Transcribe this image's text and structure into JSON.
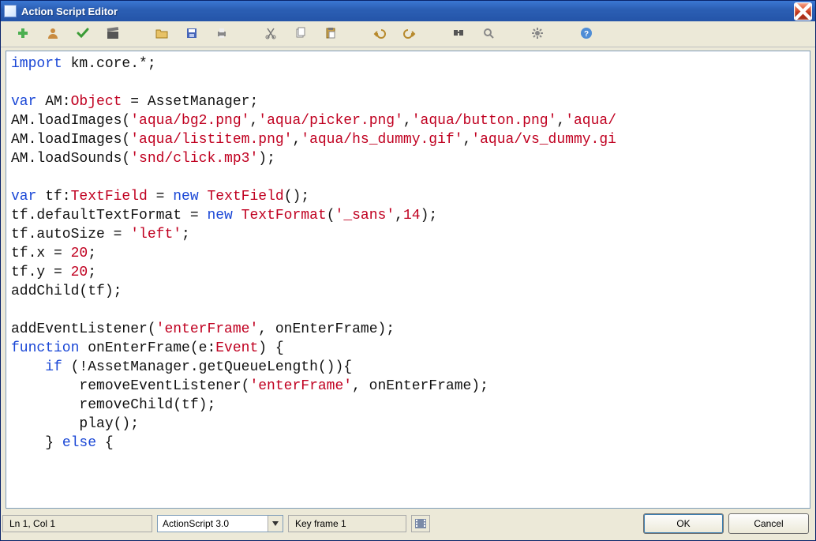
{
  "window": {
    "title": "Action Script Editor"
  },
  "toolbar": {
    "icons": [
      "add",
      "user",
      "check",
      "clapper",
      "_sep",
      "open",
      "save",
      "print",
      "_sep",
      "cut",
      "copy",
      "paste",
      "_sep",
      "undo",
      "redo",
      "_sep",
      "find",
      "goto",
      "_sep",
      "settings",
      "_sep",
      "help"
    ]
  },
  "code": {
    "tokens": [
      [
        [
          "kw",
          "import"
        ],
        [
          "",
          " km.core.*;"
        ]
      ],
      [],
      [
        [
          "kw",
          "var"
        ],
        [
          "",
          " AM:"
        ],
        [
          "typ",
          "Object"
        ],
        [
          "",
          " = AssetManager;"
        ]
      ],
      [
        [
          "",
          "AM.loadImages("
        ],
        [
          "str",
          "'aqua/bg2.png'"
        ],
        [
          "",
          ","
        ],
        [
          "str",
          "'aqua/picker.png'"
        ],
        [
          "",
          ","
        ],
        [
          "str",
          "'aqua/button.png'"
        ],
        [
          "",
          ","
        ],
        [
          "str",
          "'aqua/"
        ]
      ],
      [
        [
          "",
          "AM.loadImages("
        ],
        [
          "str",
          "'aqua/listitem.png'"
        ],
        [
          "",
          ","
        ],
        [
          "str",
          "'aqua/hs_dummy.gif'"
        ],
        [
          "",
          ","
        ],
        [
          "str",
          "'aqua/vs_dummy.gi"
        ]
      ],
      [
        [
          "",
          "AM.loadSounds("
        ],
        [
          "str",
          "'snd/click.mp3'"
        ],
        [
          "",
          ");"
        ]
      ],
      [],
      [
        [
          "kw",
          "var"
        ],
        [
          "",
          " tf:"
        ],
        [
          "typ",
          "TextField"
        ],
        [
          "",
          " = "
        ],
        [
          "kw",
          "new"
        ],
        [
          "",
          " "
        ],
        [
          "typ",
          "TextField"
        ],
        [
          "",
          "();"
        ]
      ],
      [
        [
          "",
          "tf.defaultTextFormat = "
        ],
        [
          "kw",
          "new"
        ],
        [
          "",
          " "
        ],
        [
          "typ",
          "TextFormat"
        ],
        [
          "",
          "("
        ],
        [
          "str",
          "'_sans'"
        ],
        [
          "",
          ","
        ],
        [
          "num",
          "14"
        ],
        [
          "",
          ");"
        ]
      ],
      [
        [
          "",
          "tf.autoSize = "
        ],
        [
          "str",
          "'left'"
        ],
        [
          "",
          ";"
        ]
      ],
      [
        [
          "",
          "tf.x = "
        ],
        [
          "num",
          "20"
        ],
        [
          "",
          ";"
        ]
      ],
      [
        [
          "",
          "tf.y = "
        ],
        [
          "num",
          "20"
        ],
        [
          "",
          ";"
        ]
      ],
      [
        [
          "",
          "addChild(tf);"
        ]
      ],
      [],
      [
        [
          "",
          "addEventListener("
        ],
        [
          "str",
          "'enterFrame'"
        ],
        [
          "",
          ", onEnterFrame);"
        ]
      ],
      [
        [
          "kw",
          "function"
        ],
        [
          "",
          " onEnterFrame(e:"
        ],
        [
          "typ",
          "Event"
        ],
        [
          "",
          ") {"
        ]
      ],
      [
        [
          "",
          "    "
        ],
        [
          "kw",
          "if"
        ],
        [
          "",
          " (!AssetManager.getQueueLength()){"
        ]
      ],
      [
        [
          "",
          "        removeEventListener("
        ],
        [
          "str",
          "'enterFrame'"
        ],
        [
          "",
          ", onEnterFrame);"
        ]
      ],
      [
        [
          "",
          "        removeChild(tf);"
        ]
      ],
      [
        [
          "",
          "        play();"
        ]
      ],
      [
        [
          "",
          "    } "
        ],
        [
          "kw",
          "else"
        ],
        [
          "",
          " {"
        ]
      ]
    ]
  },
  "status": {
    "cursor": "Ln 1, Col 1",
    "language": "ActionScript 3.0",
    "keyframe": "Key frame 1"
  },
  "buttons": {
    "ok": "OK",
    "cancel": "Cancel"
  },
  "colors": {
    "keyword": "#1a47d6",
    "type_string_num": "#c00020",
    "titlebar_start": "#3b77d3",
    "titlebar_end": "#2454a8",
    "chrome_bg": "#ece9d8"
  }
}
